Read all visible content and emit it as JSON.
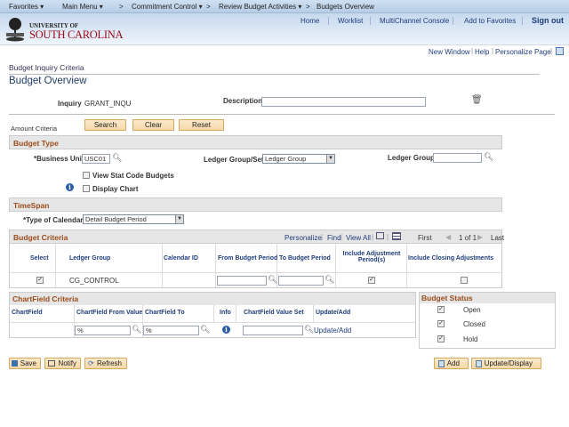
{
  "nav": {
    "items": [
      "Favorites ▾",
      "Main Menu ▾",
      ">",
      "Commitment Control ▾",
      ">",
      "Review Budget Activities ▾",
      ">",
      "Budgets Overview"
    ]
  },
  "header": {
    "links": [
      "Home",
      "Worklist",
      "MultiChannel Console",
      "Add to Favorites",
      "Sign out"
    ],
    "logo_top": "UNIVERSITY OF",
    "logo_bottom": "SOUTH CAROLINA"
  },
  "util": {
    "new_window": "New Window",
    "help": "Help",
    "personalize": "Personalize Page"
  },
  "page": {
    "breadcrumb": "Budget Inquiry Criteria",
    "title": "Budget Overview"
  },
  "inquiry": {
    "label": "Inquiry",
    "value": "GRANT_INQU",
    "description_label": "Description",
    "description": ""
  },
  "amount_criteria": "Amount Criteria",
  "buttons": {
    "search": "Search",
    "clear": "Clear",
    "reset": "Reset",
    "save": "Save",
    "notify": "Notify",
    "refresh": "Refresh",
    "add": "Add",
    "update_display": "Update/Display"
  },
  "budget_type": {
    "title": "Budget Type",
    "business_unit_label": "*Business Unit",
    "business_unit": "USC01",
    "ledger_group_set_label": "Ledger Group/Set",
    "ledger_group_set": "Ledger Group",
    "ledger_group_label": "Ledger Group",
    "ledger_group": "",
    "view_stat": "View Stat Code Budgets",
    "display_chart": "Display Chart"
  },
  "timespan": {
    "title": "TimeSpan",
    "calendar_label": "*Type of Calendar",
    "calendar": "Detail Budget Period"
  },
  "budget_criteria": {
    "title": "Budget Criteria",
    "personalize": "Personalize",
    "find": "Find",
    "view_all": "View All",
    "first": "First",
    "count": "1 of 1",
    "last": "Last",
    "columns": [
      "Select",
      "Ledger Group",
      "Calendar ID",
      "From Budget Period",
      "To Budget Period",
      "Include Adjustment Period(s)",
      "Include Closing Adjustments"
    ],
    "row": {
      "select": true,
      "ledger_group": "CG_CONTROL",
      "calendar_id": "",
      "from": "",
      "to": "",
      "include_adj": true,
      "include_closing": false
    }
  },
  "chartfield": {
    "title": "ChartField Criteria",
    "columns": [
      "ChartField",
      "ChartField From Value",
      "ChartField To",
      "Info",
      "ChartField Value Set",
      "Update/Add"
    ],
    "row": {
      "chartfield": "",
      "from": "%",
      "to": "%",
      "value_set": "",
      "update_add": "Update/Add"
    }
  },
  "budget_status": {
    "title": "Budget Status",
    "items": [
      {
        "label": "Open",
        "checked": true
      },
      {
        "label": "Closed",
        "checked": true
      },
      {
        "label": "Hold",
        "checked": true
      }
    ]
  }
}
